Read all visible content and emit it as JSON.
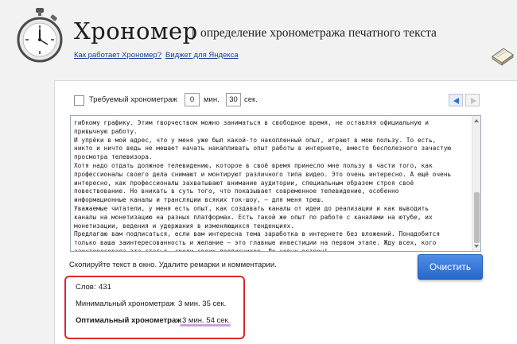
{
  "header": {
    "title": "Хрономер",
    "separator": "|",
    "subtitle": "определение хронометража печатного текста",
    "links": [
      "Как работает Хрономер?",
      "Виджет для Яндекса"
    ]
  },
  "settings": {
    "required_label": "Требуемый хронометраж",
    "minutes_value": "0",
    "minutes_unit": "мин.",
    "seconds_value": "30",
    "seconds_unit": "сек."
  },
  "text_lines": [
    "гибкому графику. Этим творчеством можно заниматься в свободное время, не оставляя официальную и",
    "привычную работу.",
    "И упрёки в мой адрес, что у меня уже был какой-то накопленный опыт, играют в мою пользу. То есть,",
    "никто и ничто ведь не мешает начать накапливать опыт работы в интернете, вместо бесполезного зачастую",
    "просмотра телевизора.",
    "Хотя надо отдать должное телевидению, которое в своё время принесло мне пользу в части того, как",
    "профессионалы своего дела снимают и монтируют различного типа видео. Это очень интересно. А ещё очень",
    "интересно, как профессионалы захватывают внимание аудитории, специальным образом строя своё",
    "повествование. Но вникать в суть того, что показывает современное телевидение, особенно",
    "информационные каналы и трансляции всяких ток-шоу, – для меня треш.",
    "Уважаемые читатели, у меня есть опыт, как создавать каналы от идеи до реализации и как выводить",
    "каналы на монетизацию на разных платформах. Есть такой же опыт по работе с каналами на ютубе, их",
    "монетизации, ведения и удержания в изменяющихся тенденциях.",
    "Предлагаю вам подписаться, если вам интересна тема заработка в интернете без вложений. Понадобится",
    "только ваша заинтересованность и желание – это главные инвестиции на первом этапе. Жду всех, кого",
    "заинтересовала эта статья, среди своих подписчиков. До новых встреч!"
  ],
  "hint": "Скопируйте текст в окно. Удалите ремарки и комментарии.",
  "clear_button": "Очистить",
  "stats": {
    "words_label": "Слов:",
    "words_value": "431",
    "min_label": "Минимальный хронометраж",
    "min_value": "3 мин. 35 сек.",
    "opt_label": "Оптимальный хронометраж",
    "opt_value": "3 мин. 54 сек."
  },
  "colors": {
    "accent_blue": "#2668cc",
    "highlight_red": "#d9292c",
    "link_blue": "#1a3f9c"
  }
}
